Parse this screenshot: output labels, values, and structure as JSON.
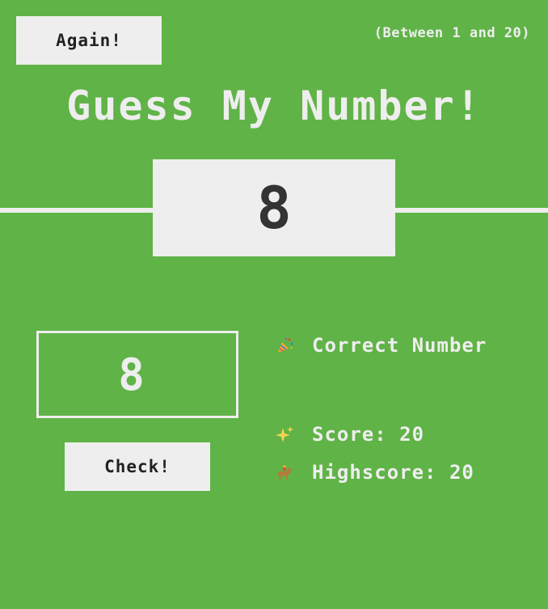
{
  "header": {
    "again_label": "Again!",
    "range_text": "(Between 1 and 20)"
  },
  "title": "Guess My Number!",
  "secret": {
    "value": "8"
  },
  "guess": {
    "value": "8"
  },
  "check_label": "Check!",
  "message": {
    "icon": "party-popper-icon",
    "text": "Correct Number"
  },
  "score": {
    "icon": "sparkles-icon",
    "label": "Score:",
    "value": "20"
  },
  "highscore": {
    "icon": "horse-racing-icon",
    "label": "Highscore:",
    "value": "20"
  },
  "colors": {
    "background": "#60b347",
    "foreground": "#eeeeee",
    "button_text": "#222222",
    "secret_text": "#333333"
  }
}
